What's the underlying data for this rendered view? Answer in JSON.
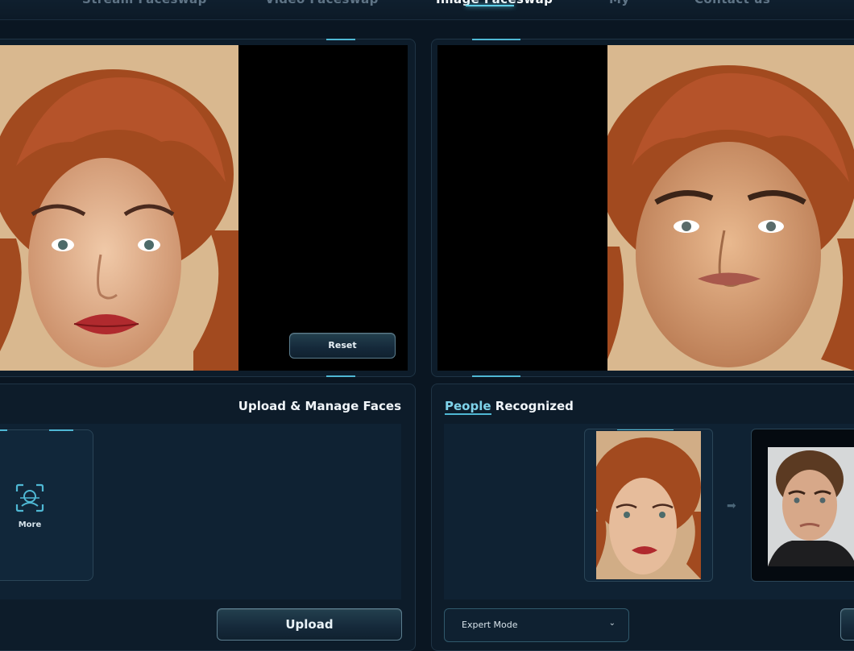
{
  "nav": {
    "items": [
      "Stream Faceswap",
      "Video Faceswap",
      "Image Faceswap",
      "My",
      "Contact us"
    ],
    "active": "Image Faceswap"
  },
  "source_panel": {
    "reset_label": "Reset"
  },
  "upload_panel": {
    "title": "Upload & Manage Faces",
    "more_label": "More",
    "upload_label": "Upload"
  },
  "people_panel": {
    "title_highlight": "People",
    "title_rest": "Recognized",
    "mode_select": "Expert Mode",
    "arrow_icon": "arrow-right-icon"
  },
  "colors": {
    "accent": "#4fb8d4",
    "bg": "#0a1622",
    "panel": "#0d1c2a",
    "highlight": "#7fd3ea"
  }
}
